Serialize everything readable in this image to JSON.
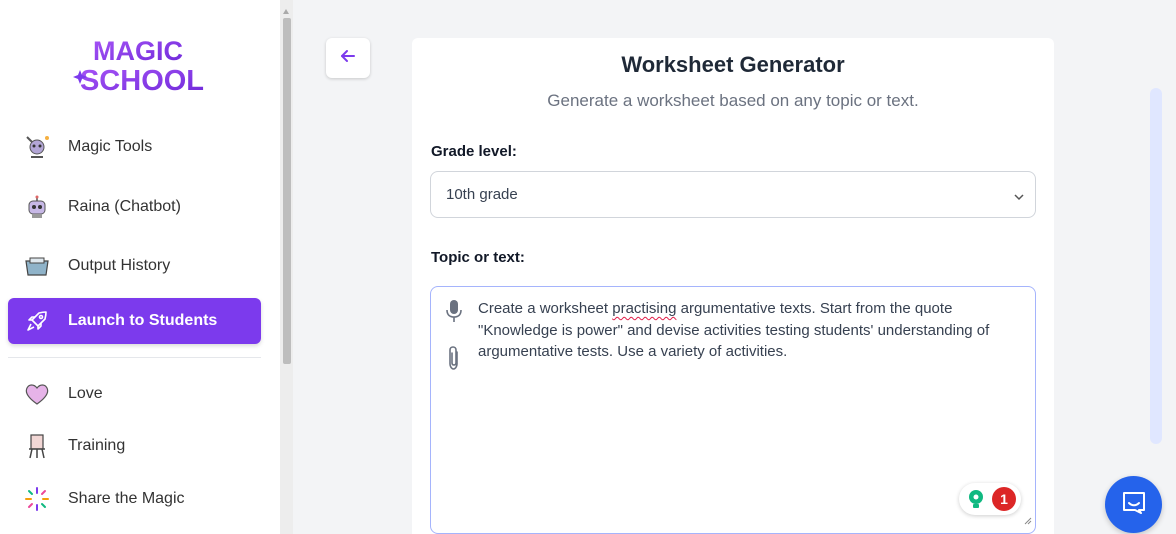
{
  "brand": {
    "line1": "MAGIC",
    "line2": "SCHOOL"
  },
  "sidebar": {
    "items": [
      {
        "label": "Magic Tools",
        "icon": "magic-tools-icon"
      },
      {
        "label": "Raina (Chatbot)",
        "icon": "robot-icon"
      },
      {
        "label": "Output History",
        "icon": "history-icon"
      },
      {
        "label": "Launch to Students",
        "icon": "rocket-icon",
        "active": true
      },
      {
        "label": "Love",
        "icon": "heart-icon"
      },
      {
        "label": "Training",
        "icon": "easel-icon"
      },
      {
        "label": "Share the Magic",
        "icon": "sparkle-icon"
      }
    ]
  },
  "page": {
    "title": "Worksheet Generator",
    "subtitle": "Generate a worksheet based on any topic or text."
  },
  "form": {
    "grade_label": "Grade level:",
    "grade_value": "10th grade",
    "topic_label": "Topic or text:",
    "topic_before": "Create a worksheet ",
    "topic_flagged": "practising",
    "topic_after": " argumentative texts. Start from the quote \"Knowledge is power\" and devise activities testing students' understanding of argumentative tests. Use a variety of activities."
  },
  "grammarly": {
    "issue_count": "1"
  },
  "colors": {
    "accent": "#7c3aed",
    "chat": "#2563eb",
    "error": "#dc2626"
  }
}
